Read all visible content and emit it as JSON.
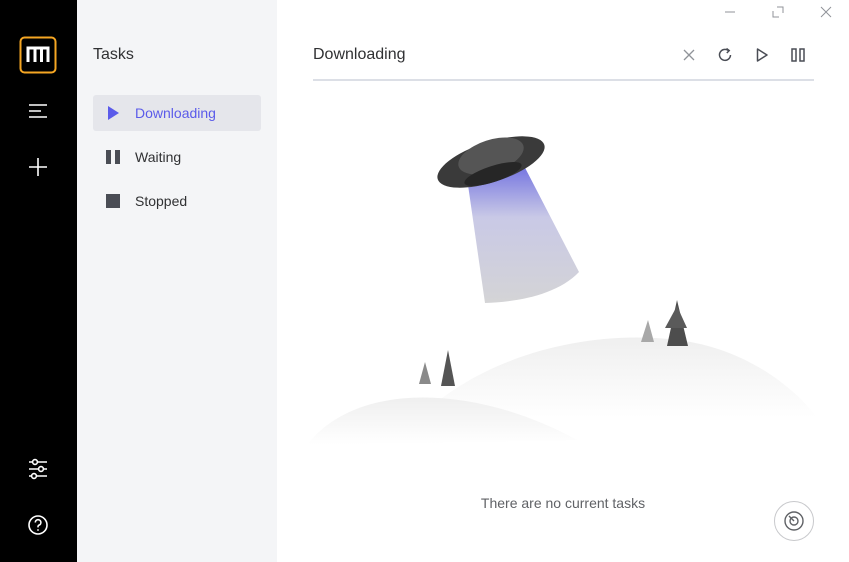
{
  "app": {
    "logo_icon": "motrix-logo-icon",
    "accent": "#5b5bea"
  },
  "rail": {
    "items": [
      {
        "name": "menu-icon"
      },
      {
        "name": "plus-icon"
      },
      {
        "name": "sliders-icon"
      },
      {
        "name": "help-icon"
      }
    ]
  },
  "sidebar": {
    "title": "Tasks",
    "items": [
      {
        "label": "Downloading",
        "icon": "play-icon",
        "active": true
      },
      {
        "label": "Waiting",
        "icon": "pause-icon",
        "active": false
      },
      {
        "label": "Stopped",
        "icon": "stop-icon",
        "active": false
      }
    ]
  },
  "main": {
    "title": "Downloading",
    "toolbar": [
      "close-icon",
      "refresh-icon",
      "play-icon",
      "pause-icon"
    ],
    "empty_text": "There are no current tasks",
    "speed_icon": "speedometer-icon"
  }
}
